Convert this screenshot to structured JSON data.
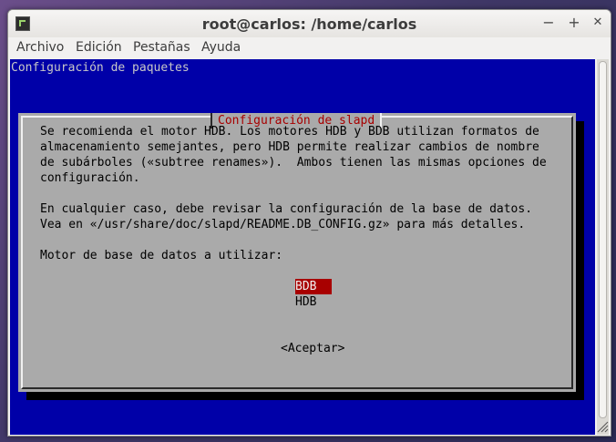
{
  "window": {
    "title": "root@carlos: /home/carlos",
    "minimize_icon": "−",
    "maximize_icon": "+",
    "close_icon": "✕"
  },
  "menubar": {
    "items": [
      "Archivo",
      "Edición",
      "Pestañas",
      "Ayuda"
    ]
  },
  "terminal": {
    "header": "Configuración de paquetes",
    "background_color": "#0000a8",
    "dialog": {
      "title": "Configuración de slapd",
      "lines": [
        "Se recomienda el motor HDB. Los motores HDB y BDB utilizan formatos de",
        "almacenamiento semejantes, pero HDB permite realizar cambios de nombre",
        "de subárboles («subtree renames»).  Ambos tienen las mismas opciones de",
        "configuración.",
        "En cualquier caso, debe revisar la configuración de la base de datos.",
        "Vea en «/usr/share/doc/slapd/README.DB_CONFIG.gz» para más detalles.",
        "Motor de base de datos a utilizar:"
      ],
      "options": [
        "BDB",
        "HDB"
      ],
      "selected_option": "BDB",
      "accept_label": "<Aceptar>",
      "title_color": "#a80000",
      "selection_color": "#a80000"
    }
  }
}
